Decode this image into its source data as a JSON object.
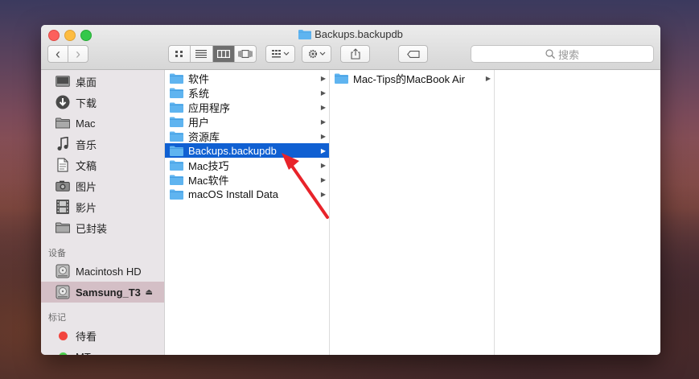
{
  "window": {
    "title": "Backups.backupdb"
  },
  "toolbar": {
    "back": "‹",
    "forward": "›",
    "search_placeholder": "搜索"
  },
  "sidebar": {
    "favorites": [
      {
        "label": "桌面",
        "icon": "desktop-icon"
      },
      {
        "label": "下载",
        "icon": "download-icon"
      },
      {
        "label": "Mac",
        "icon": "folder-icon"
      },
      {
        "label": "音乐",
        "icon": "music-icon"
      },
      {
        "label": "文稿",
        "icon": "document-icon"
      },
      {
        "label": "图片",
        "icon": "camera-icon"
      },
      {
        "label": "影片",
        "icon": "film-icon"
      },
      {
        "label": "已封装",
        "icon": "folder-icon"
      }
    ],
    "devices_header": "设备",
    "devices": [
      {
        "label": "Macintosh HD",
        "icon": "disk-icon"
      },
      {
        "label": "Samsung_T3",
        "icon": "disk-icon",
        "eject": "⏏"
      }
    ],
    "tags_header": "标记",
    "tags": [
      {
        "label": "待看",
        "color": "#f2443e"
      },
      {
        "label": "MT",
        "color": "#4cd04c"
      }
    ]
  },
  "columns": {
    "col1": [
      {
        "label": "软件"
      },
      {
        "label": "系统"
      },
      {
        "label": "应用程序"
      },
      {
        "label": "用户"
      },
      {
        "label": "资源库"
      },
      {
        "label": "Backups.backupdb"
      },
      {
        "label": "Mac技巧"
      },
      {
        "label": "Mac软件"
      },
      {
        "label": "macOS Install Data"
      }
    ],
    "col2": [
      {
        "label": "Mac-Tips的MacBook Air"
      }
    ]
  },
  "colors": {
    "selection": "#1060d2",
    "folder": "#5fb4f0",
    "annotation_arrow": "#e8232a"
  }
}
